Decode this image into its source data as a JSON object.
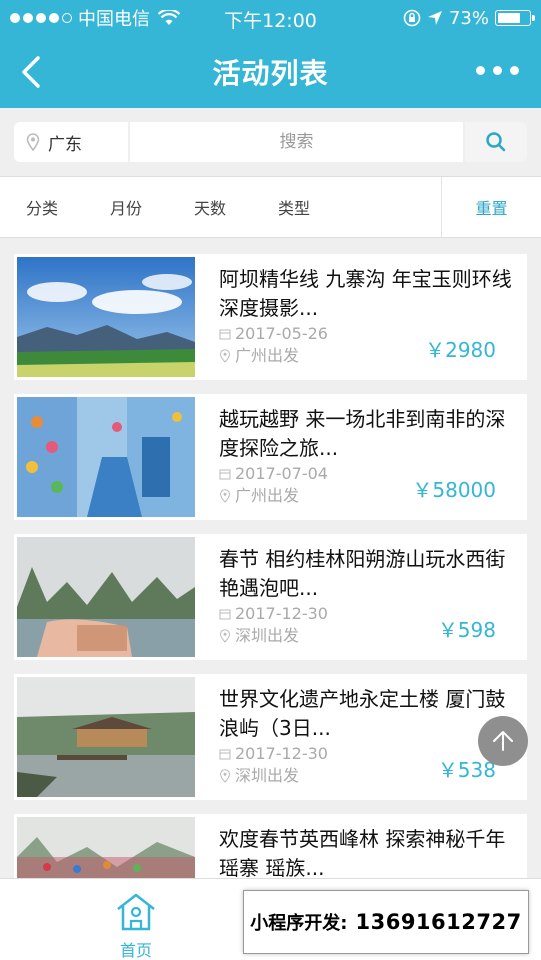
{
  "status": {
    "carrier": "中国电信",
    "time": "下午12:00",
    "battery": "73%",
    "battery_level": 0.73
  },
  "nav": {
    "title": "活动列表",
    "back_icon": "chevron-left-icon",
    "more_icon": "more-dots-icon"
  },
  "search": {
    "region": "广东",
    "placeholder": "搜索"
  },
  "filters": {
    "items": [
      "分类",
      "月份",
      "天数",
      "类型"
    ],
    "reset": "重置"
  },
  "activities": [
    {
      "title": "阿坝精华线 九寨沟 年宝玉则环线深度摄影...",
      "date": "2017-05-26",
      "departure": "广州出发",
      "price": "￥2980"
    },
    {
      "title": "越玩越野 来一场北非到南非的深度探险之旅...",
      "date": "2017-07-04",
      "departure": "广州出发",
      "price": "￥58000"
    },
    {
      "title": "春节 相约桂林阳朔游山玩水西街艳遇泡吧...",
      "date": "2017-12-30",
      "departure": "深圳出发",
      "price": "￥598"
    },
    {
      "title": "世界文化遗产地永定土楼 厦门鼓浪屿（3日...",
      "date": "2017-12-30",
      "departure": "深圳出发",
      "price": "￥538"
    },
    {
      "title": "欢度春节英西峰林 探索神秘千年瑶寨 瑶族...",
      "date": "",
      "departure": "",
      "price": ""
    }
  ],
  "tabbar": {
    "home": "首页"
  },
  "promo": {
    "label": "小程序开发:",
    "phone": "13691612727"
  },
  "colors": {
    "accent": "#35b6d6",
    "background": "#efefef"
  }
}
